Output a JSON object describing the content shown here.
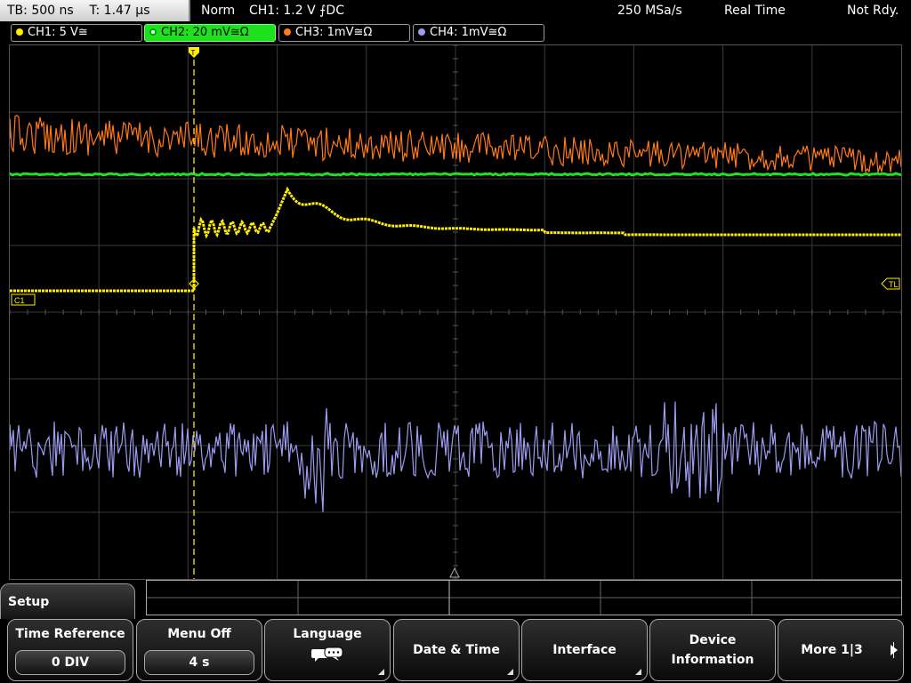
{
  "topbar": {
    "timebase": "TB: 500 ns",
    "trigger_time": "T: 1.47 µs",
    "mode": "Norm",
    "trigger_info": "CH1: 1.2 V ⨍DC",
    "sample_rate": "250 MSa/s",
    "acquisition": "Real Time",
    "status": "Not Rdy."
  },
  "channels": [
    {
      "label": "CH1: 5 V≅",
      "color": "#ffee00",
      "active": false
    },
    {
      "label": "CH2: 20 mV≅Ω",
      "color": "#20e020",
      "active": true
    },
    {
      "label": "CH3: 1mV≅Ω",
      "color": "#ff7a1a",
      "active": false
    },
    {
      "label": "CH4: 1mV≅Ω",
      "color": "#9c9cf0",
      "active": false
    }
  ],
  "scope": {
    "markers": {
      "ch1": "C1",
      "trigger_level": "TL"
    },
    "colors": {
      "grid": "#3a3a3a",
      "ch1": "#ffee00",
      "ch2": "#20e020",
      "ch3": "#ff7a1a",
      "ch4": "#9c9cf0"
    }
  },
  "menu": {
    "title": "Setup",
    "softkeys": {
      "time_reference": {
        "label": "Time Reference",
        "value": "0 DIV"
      },
      "menu_off": {
        "label": "Menu Off",
        "value": "4 s"
      },
      "language": {
        "label": "Language",
        "icon": "speech-bubbles-icon"
      },
      "date_time": {
        "label": "Date & Time"
      },
      "interface": {
        "label": "Interface"
      },
      "device_information": {
        "line1": "Device",
        "line2": "Information"
      },
      "more": {
        "label": "More 1|3"
      }
    }
  }
}
